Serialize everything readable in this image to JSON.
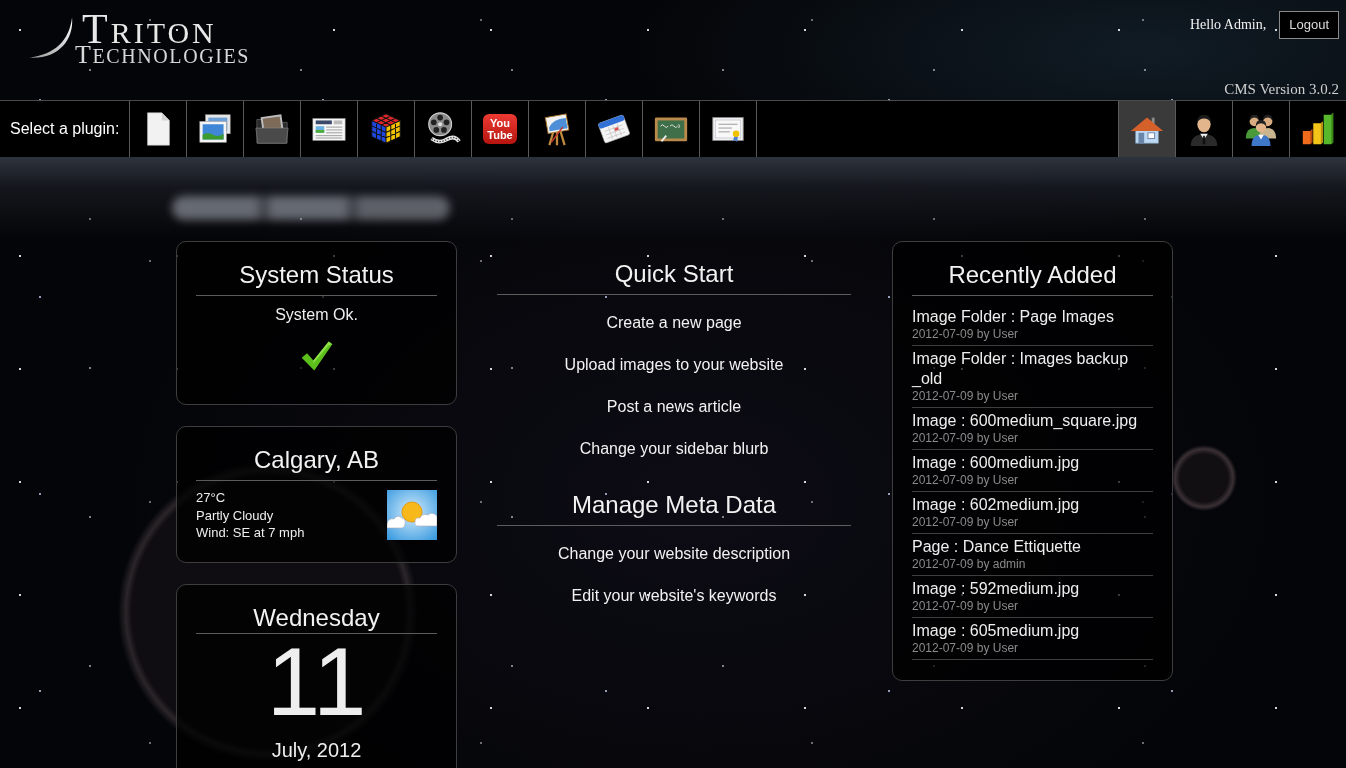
{
  "header": {
    "logo_title": "TRITON",
    "logo_subtitle": "TECHNOLOGIES",
    "greeting": "Hello Admin,",
    "logout_button": "Logout",
    "version": "CMS Version 3.0.2"
  },
  "plugin_bar": {
    "label": "Select a plugin:",
    "plugins": [
      {
        "kind": "icon",
        "selected": false
      },
      {
        "kind": "icon",
        "selected": false
      },
      {
        "kind": "icon",
        "selected": false
      },
      {
        "kind": "icon",
        "selected": false
      },
      {
        "kind": "icon",
        "selected": false
      },
      {
        "kind": "icon",
        "selected": false
      },
      {
        "kind": "logo",
        "logo_text": "You Tube",
        "selected": false
      },
      {
        "kind": "icon",
        "selected": false
      },
      {
        "kind": "icon",
        "selected": false
      },
      {
        "kind": "icon",
        "selected": false
      },
      {
        "kind": "icon",
        "selected": false
      }
    ],
    "nav": [
      {
        "selected": true
      },
      {
        "selected": false
      },
      {
        "selected": false
      },
      {
        "selected": false
      }
    ]
  },
  "system_status": {
    "title": "System Status",
    "message": "System Ok."
  },
  "weather": {
    "title": "Calgary, AB",
    "lines": [
      "27°C",
      "Partly Cloudy",
      "Wind: SE at 7 mph"
    ]
  },
  "calendar": {
    "weekday": "Wednesday",
    "day": "11",
    "month_year": "July, 2012"
  },
  "quick_start": {
    "title": "Quick Start",
    "links": [
      "Create a new page",
      "Upload images to your website",
      "Post a news article",
      "Change your sidebar blurb"
    ]
  },
  "meta_data": {
    "title": "Manage Meta Data",
    "links": [
      "Change your website description",
      "Edit your website's keywords"
    ]
  },
  "recently_added": {
    "title": "Recently Added",
    "items": [
      {
        "title": "Image Folder : Page Images",
        "meta": "2012-07-09 by User"
      },
      {
        "title": "Image Folder : Images backup _old",
        "meta": "2012-07-09 by User"
      },
      {
        "title": "Image : 600medium_square.jpg",
        "meta": "2012-07-09 by User"
      },
      {
        "title": "Image : 600medium.jpg",
        "meta": "2012-07-09 by User"
      },
      {
        "title": "Image : 602medium.jpg",
        "meta": "2012-07-09 by User"
      },
      {
        "title": "Page : Dance Ettiquette",
        "meta": "2012-07-09 by admin"
      },
      {
        "title": "Image : 592medium.jpg",
        "meta": "2012-07-09 by User"
      },
      {
        "title": "Image : 605medium.jpg",
        "meta": "2012-07-09 by User"
      }
    ]
  }
}
